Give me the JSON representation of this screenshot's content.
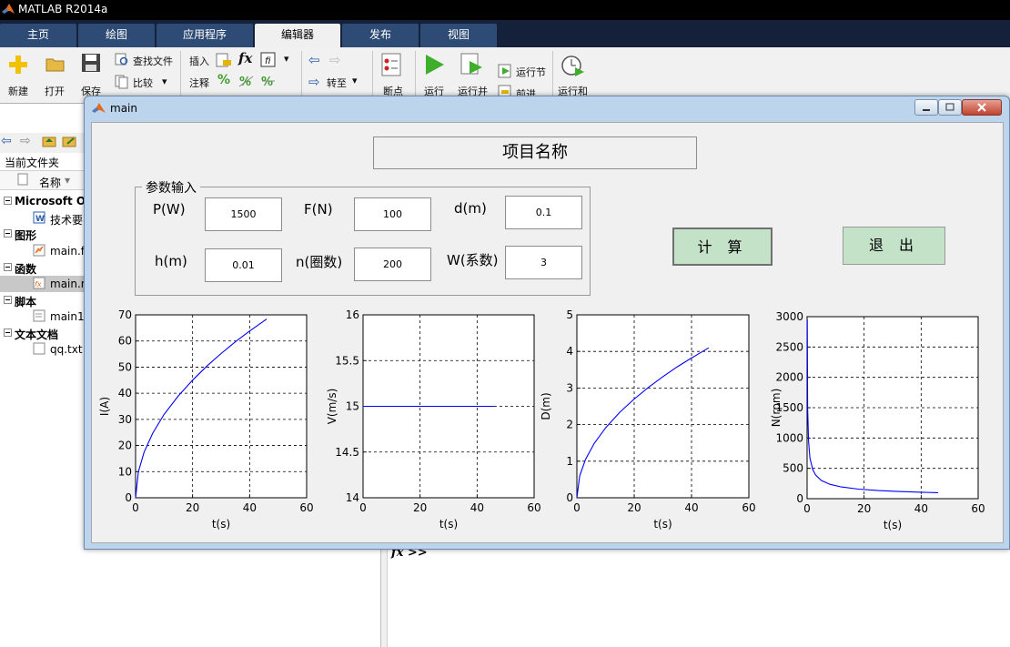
{
  "app": {
    "title": "MATLAB R2014a"
  },
  "tabs": [
    {
      "label": "主页"
    },
    {
      "label": "绘图"
    },
    {
      "label": "应用程序"
    },
    {
      "label": "编辑器"
    },
    {
      "label": "发布"
    },
    {
      "label": "视图"
    }
  ],
  "ribbon": {
    "new": "新建",
    "open": "打开",
    "save": "保存",
    "find_files": "查找文件",
    "compare": "比较",
    "insert": "插入",
    "comment": "注释",
    "goto": "转至",
    "breakpoints": "断点",
    "run": "运行",
    "run_advance": "运行并",
    "run_section": "运行节",
    "advance": "前进",
    "run_time": "运行和",
    "fx": "fx",
    "percent": "%"
  },
  "left_pane": {
    "current_folder": "当前文件夹",
    "column_name": "名称",
    "groups": [
      {
        "label": "Microsoft O",
        "items": [
          {
            "label": "技术要"
          }
        ]
      },
      {
        "label": "图形",
        "items": [
          {
            "label": "main.fi"
          }
        ]
      },
      {
        "label": "函数",
        "items": [
          {
            "label": "main.n"
          }
        ]
      },
      {
        "label": "脚本",
        "items": [
          {
            "label": "main1"
          }
        ]
      },
      {
        "label": "文本文档",
        "items": [
          {
            "label": "qq.txt"
          }
        ]
      }
    ]
  },
  "command_window": {
    "prompt": "fx >>"
  },
  "figure": {
    "title": "main",
    "project_title": "项目名称",
    "panel_title": "参数输入",
    "params": [
      {
        "label": "P(W)",
        "value": "1500"
      },
      {
        "label": "F(N)",
        "value": "100"
      },
      {
        "label": "d(m)",
        "value": "0.1"
      },
      {
        "label": "h(m)",
        "value": "0.01"
      },
      {
        "label": "n(圈数)",
        "value": "200"
      },
      {
        "label": "W(系数)",
        "value": "3"
      }
    ],
    "calc_button": "计 算",
    "exit_button": "退 出"
  },
  "chart_data": [
    {
      "type": "line",
      "xlabel": "t(s)",
      "ylabel": "I(A)",
      "xlim": [
        0,
        60
      ],
      "ylim": [
        0,
        70
      ],
      "xticks": [
        "0",
        "20",
        "40",
        "60"
      ],
      "yticks": [
        "0",
        "10",
        "20",
        "30",
        "40",
        "50",
        "60",
        "70"
      ],
      "grid": true,
      "series_color": "#0000ff",
      "points": [
        [
          0,
          0
        ],
        [
          1,
          10
        ],
        [
          3,
          17.5
        ],
        [
          6,
          24.7
        ],
        [
          10,
          31.9
        ],
        [
          15,
          39
        ],
        [
          20,
          45
        ],
        [
          25,
          50.4
        ],
        [
          30,
          55.2
        ],
        [
          35,
          59.7
        ],
        [
          40,
          63.8
        ],
        [
          46,
          68.4
        ]
      ]
    },
    {
      "type": "line",
      "xlabel": "t(s)",
      "ylabel": "V(m/s)",
      "xlim": [
        0,
        60
      ],
      "ylim": [
        14,
        16
      ],
      "xticks": [
        "0",
        "20",
        "40",
        "60"
      ],
      "yticks": [
        "14",
        "14.5",
        "15",
        "15.5",
        "16"
      ],
      "grid": true,
      "series_color": "#0000ff",
      "points": [
        [
          0,
          15
        ],
        [
          46,
          15
        ]
      ]
    },
    {
      "type": "line",
      "xlabel": "t(s)",
      "ylabel": "D(m)",
      "xlim": [
        0,
        60
      ],
      "ylim": [
        0,
        5
      ],
      "xticks": [
        "0",
        "20",
        "40",
        "60"
      ],
      "yticks": [
        "0",
        "1",
        "2",
        "3",
        "4",
        "5"
      ],
      "grid": true,
      "series_color": "#0000ff",
      "points": [
        [
          0,
          0
        ],
        [
          1,
          0.6
        ],
        [
          3,
          1.05
        ],
        [
          6,
          1.48
        ],
        [
          10,
          1.91
        ],
        [
          15,
          2.34
        ],
        [
          20,
          2.7
        ],
        [
          25,
          3.02
        ],
        [
          30,
          3.31
        ],
        [
          35,
          3.58
        ],
        [
          40,
          3.82
        ],
        [
          46,
          4.1
        ]
      ]
    },
    {
      "type": "line",
      "xlabel": "t(s)",
      "ylabel": "N(rpm)",
      "xlim": [
        0,
        60
      ],
      "ylim": [
        0,
        3000
      ],
      "xticks": [
        "0",
        "20",
        "40",
        "60"
      ],
      "yticks": [
        "0",
        "500",
        "1000",
        "1500",
        "2000",
        "2500",
        "3000"
      ],
      "grid": true,
      "series_color": "#0000ff",
      "points": [
        [
          0.05,
          2950
        ],
        [
          0.2,
          1500
        ],
        [
          0.5,
          950
        ],
        [
          1,
          670
        ],
        [
          2,
          475
        ],
        [
          3,
          390
        ],
        [
          5,
          300
        ],
        [
          8,
          237
        ],
        [
          12,
          194
        ],
        [
          18,
          158
        ],
        [
          25,
          134
        ],
        [
          32,
          118
        ],
        [
          40,
          106
        ],
        [
          46,
          99
        ]
      ]
    }
  ]
}
